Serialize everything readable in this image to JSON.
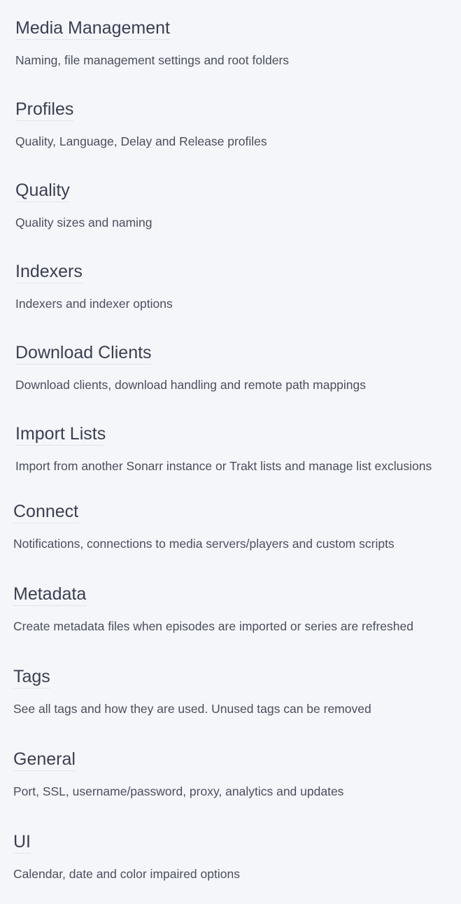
{
  "settings": [
    {
      "title": "Media Management",
      "summary": "Naming, file management settings and root folders"
    },
    {
      "title": "Profiles",
      "summary": "Quality, Language, Delay and Release profiles"
    },
    {
      "title": "Quality",
      "summary": "Quality sizes and naming"
    },
    {
      "title": "Indexers",
      "summary": "Indexers and indexer options"
    },
    {
      "title": "Download Clients",
      "summary": "Download clients, download handling and remote path mappings"
    },
    {
      "title": "Import Lists",
      "summary": "Import from another Sonarr instance or Trakt lists and manage list exclusions"
    },
    {
      "title": "Connect",
      "summary": "Notifications, connections to media servers/players and custom scripts"
    },
    {
      "title": "Metadata",
      "summary": "Create metadata files when episodes are imported or series are refreshed"
    },
    {
      "title": "Tags",
      "summary": "See all tags and how they are used. Unused tags can be removed"
    },
    {
      "title": "General",
      "summary": "Port, SSL, username/password, proxy, analytics and updates"
    },
    {
      "title": "UI",
      "summary": "Calendar, date and color impaired options"
    }
  ]
}
